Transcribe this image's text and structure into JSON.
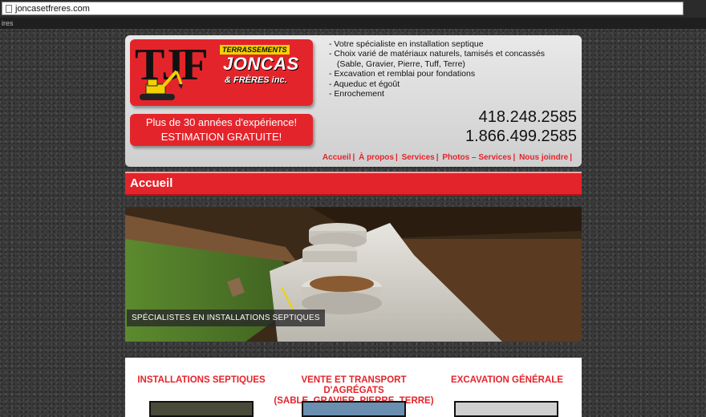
{
  "browser": {
    "url": "joncasetfreres.com",
    "bookmarks_text": "ires"
  },
  "logo": {
    "monogram": "TJF",
    "tag": "TERRASSEMENTS",
    "name": "JONCAS",
    "suffix": "& FRÈRES inc."
  },
  "badge": {
    "line1": "Plus de 30 années d'expérience!",
    "line2": "ESTIMATION GRATUITE!"
  },
  "features": [
    "- Votre spécialiste en installation septique",
    "- Choix varié de matériaux naturels, tamisés et concassés",
    "  (Sable, Gravier, Pierre, Tuff, Terre)",
    "- Excavation et remblai pour fondations",
    "- Aqueduc et égoût",
    "- Enrochement"
  ],
  "phones": [
    "418.248.2585",
    "1.866.499.2585"
  ],
  "nav": [
    "Accueil",
    "À propos",
    "Services",
    "Photos – Services",
    "Nous joindre"
  ],
  "page_title": "Accueil",
  "hero": {
    "caption": "SPÉCIALISTES EN INSTALLATIONS SEPTIQUES"
  },
  "services": [
    {
      "title_l1": "INSTALLATIONS SEPTIQUES",
      "title_l2": ""
    },
    {
      "title_l1": "VENTE ET TRANSPORT D'AGRÉGATS",
      "title_l2": "(SABLE, GRAVIER, PIERRE, TERRE)"
    },
    {
      "title_l1": "EXCAVATION GÉNÉRALE",
      "title_l2": ""
    }
  ],
  "colors": {
    "brand_red": "#e4242b",
    "brand_yellow": "#f2d200"
  }
}
